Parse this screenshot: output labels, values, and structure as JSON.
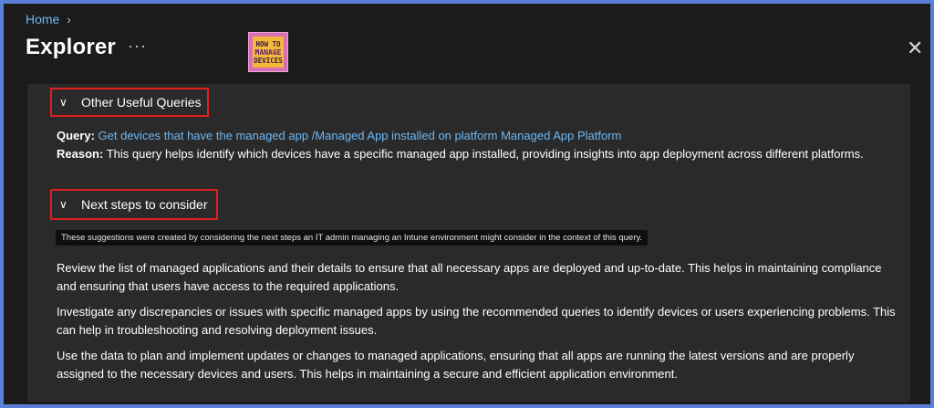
{
  "breadcrumb": {
    "home": "Home"
  },
  "header": {
    "title": "Explorer",
    "more": "···",
    "close": "✕"
  },
  "logo": {
    "line1": "HOW TO",
    "line2": "MANAGE",
    "line3": "DEVICES"
  },
  "sections": {
    "useful_queries": {
      "label": "Other Useful Queries",
      "query_label": "Query:",
      "query_link": "Get devices that have the managed app /Managed App installed on platform Managed App Platform",
      "reason_label": "Reason:",
      "reason_text": "This query helps identify which devices have a specific managed app installed, providing insights into app deployment across different platforms."
    },
    "next_steps": {
      "label": "Next steps to consider",
      "note": "These suggestions were created by considering the next steps an IT admin managing an Intune environment might consider in the context of this query.",
      "paragraphs": [
        "Review the list of managed applications and their details to ensure that all necessary apps are deployed and up-to-date. This helps in maintaining compliance and ensuring that users have access to the required applications.",
        "Investigate any discrepancies or issues with specific managed apps by using the recommended queries to identify devices or users experiencing problems. This can help in troubleshooting and resolving deployment issues.",
        "Use the data to plan and implement updates or changes to managed applications, ensuring that all apps are running the latest versions and are properly assigned to the necessary devices and users. This helps in maintaining a secure and efficient application environment."
      ]
    }
  },
  "colors": {
    "accent_link": "#6cb8f6",
    "highlight_box": "#e02020",
    "background": "#1b1b1b",
    "panel": "#2a2a2a"
  },
  "icons": {
    "chevron": "chevron-down-icon",
    "close": "close-icon",
    "more": "more-icon"
  }
}
